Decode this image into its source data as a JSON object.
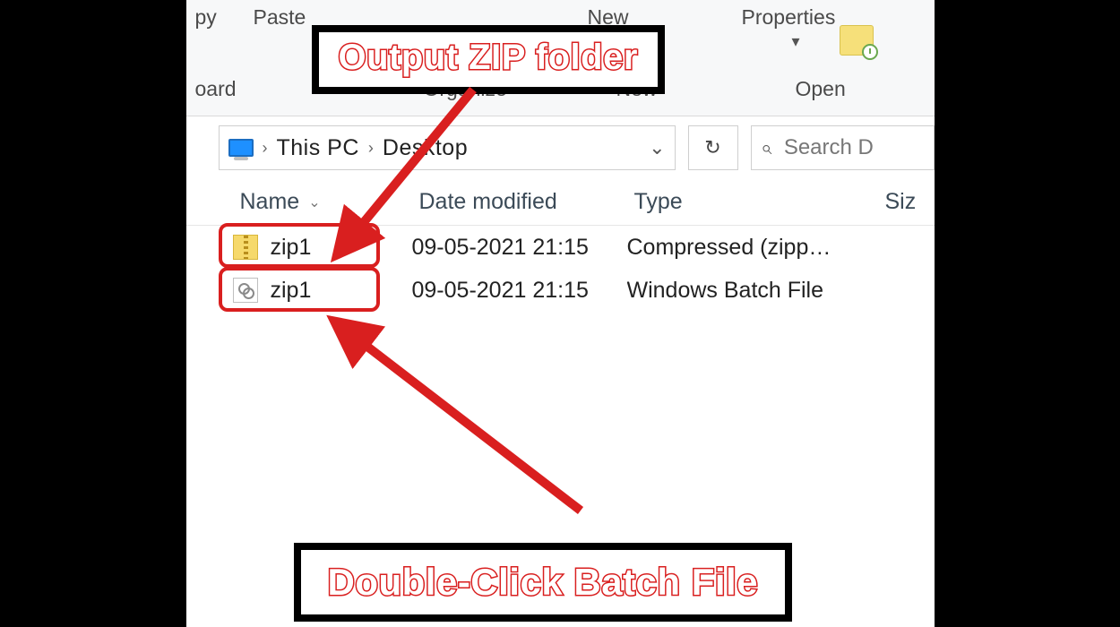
{
  "ribbon": {
    "copy_fragment": "py",
    "paste": "Paste",
    "new": "New",
    "properties": "Properties",
    "dropdown_glyph": "▾",
    "clipboard_fragment": "oard",
    "organize": "Organize",
    "new_group": "New",
    "open": "Open"
  },
  "breadcrumb": {
    "sep": "›",
    "loc1": "This PC",
    "loc2": "Desktop",
    "dropdown": "⌄",
    "refresh": "↻"
  },
  "search": {
    "glyph": "⌕",
    "placeholder": "Search D"
  },
  "columns": {
    "name": "Name",
    "date": "Date modified",
    "type": "Type",
    "size": "Siz",
    "dd": "⌄"
  },
  "files": {
    "row1": {
      "name": "zip1",
      "date": "09-05-2021 21:15",
      "type": "Compressed (zipp…"
    },
    "row2": {
      "name": "zip1",
      "date": "09-05-2021 21:15",
      "type": "Windows Batch File"
    }
  },
  "annotations": {
    "top": "Output ZIP folder",
    "bottom": "Double-Click Batch File"
  }
}
